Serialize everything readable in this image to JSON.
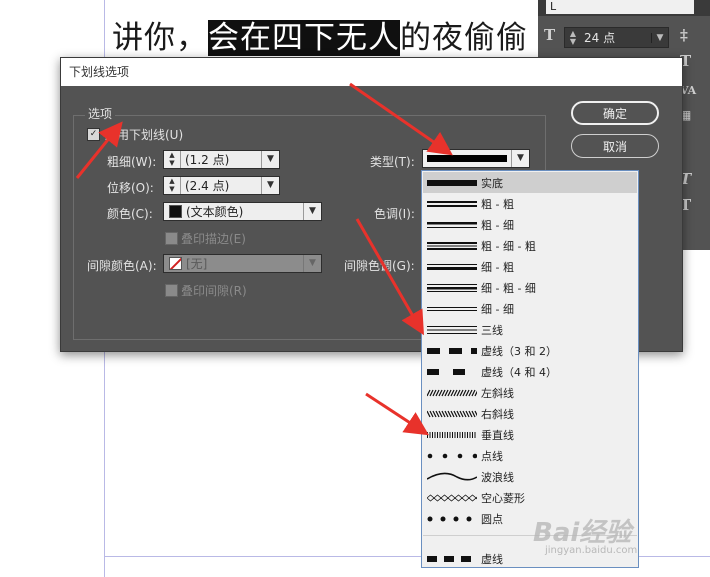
{
  "document": {
    "text_before": "讲你，",
    "text_highlighted": "会在四下无人",
    "text_after": "的夜偷偷"
  },
  "char_panel": {
    "font_field": "L",
    "font_size": "24 点"
  },
  "dialog": {
    "title": "下划线选项",
    "group_label": "选项",
    "enable_label": "启用下划线(U)",
    "enable_checked": true,
    "weight_label": "粗细(W):",
    "weight_value": "(1.2 点)",
    "offset_label": "位移(O):",
    "offset_value": "(2.4 点)",
    "color_label": "颜色(C):",
    "color_value": "(文本颜色)",
    "overprint_stroke_label": "叠印描边(E)",
    "gap_color_label": "间隙颜色(A):",
    "gap_color_value": "[无]",
    "overprint_gap_label": "叠印间隙(R)",
    "type_label": "类型(T):",
    "tint_label": "色调(I):",
    "gap_tint_label": "间隙色调(G):",
    "ok_label": "确定",
    "cancel_label": "取消"
  },
  "type_dropdown": {
    "items": [
      {
        "label": "实底",
        "style": "solid",
        "selected": true
      },
      {
        "label": "粗 - 粗",
        "style": "thick-thick"
      },
      {
        "label": "粗 - 细",
        "style": "thick-thin"
      },
      {
        "label": "粗 - 细 - 粗",
        "style": "thick-thin-thick"
      },
      {
        "label": "细 - 粗",
        "style": "thin-thick"
      },
      {
        "label": "细 - 粗 - 细",
        "style": "thin-thick-thin"
      },
      {
        "label": "细 - 细",
        "style": "thin-thin"
      },
      {
        "label": "三线",
        "style": "triple"
      },
      {
        "label": "虚线（3 和 2）",
        "style": "dash-3-2"
      },
      {
        "label": "虚线（4 和 4）",
        "style": "dash-4-4"
      },
      {
        "label": "左斜线",
        "style": "left-slant"
      },
      {
        "label": "右斜线",
        "style": "right-slant"
      },
      {
        "label": "垂直线",
        "style": "vertical"
      },
      {
        "label": "点线",
        "style": "dotted"
      },
      {
        "label": "波浪线",
        "style": "wavy"
      },
      {
        "label": "空心菱形",
        "style": "diamond"
      },
      {
        "label": "圆点",
        "style": "dots"
      }
    ],
    "extra_item": {
      "label": "虚线",
      "style": "dash"
    }
  },
  "watermark": {
    "logo": "Bai经验",
    "sub": "jingyan.baidu.com"
  },
  "colors": {
    "dialog_bg": "#535353",
    "arrow": "#e8322b",
    "highlight": "#101010",
    "selection": "#cfcfcf"
  }
}
